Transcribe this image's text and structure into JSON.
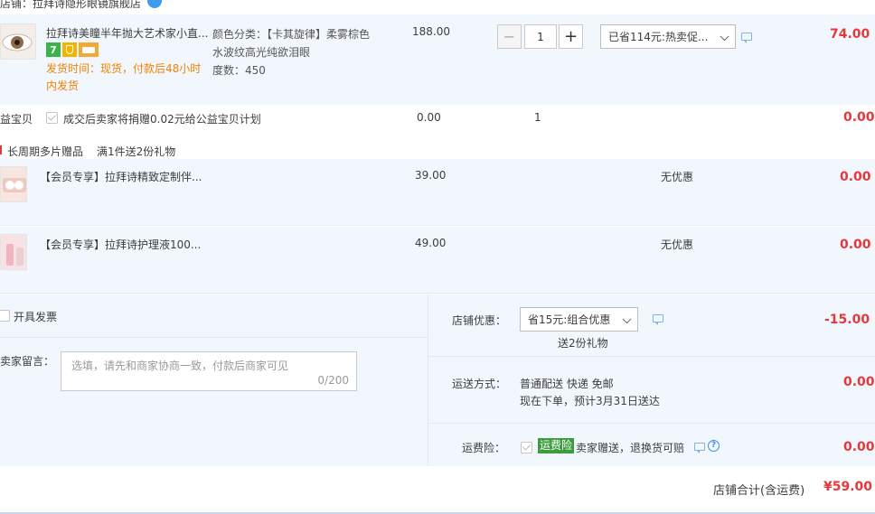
{
  "store": {
    "label": "店铺：拉拜诗隐形眼镜旗舰店"
  },
  "item": {
    "title": "拉拜诗美瞳半年抛大艺术家小直...",
    "ship_line1": "发货时间：现货，付款后48小时",
    "ship_line2": "内发货",
    "attr_line1": "颜色分类：【卡其旋律】柔雾棕色",
    "attr_line2": "水波纹高光纯欲泪眼",
    "attr_line3": "度数：450",
    "price": "188.00",
    "quantity": "1",
    "promo": "已省114元:热卖促...",
    "total": "74.00",
    "badge1": "7",
    "minus": "−",
    "plus": "+"
  },
  "charity": {
    "label": "公益宝贝",
    "text": "成交后卖家将捐赠0.02元给公益宝贝计划",
    "price": "0.00",
    "qty": "1",
    "total": "0.00"
  },
  "gifts": {
    "header_tag": "长周期多片赠品",
    "header_text": "满1件送2份礼物",
    "items": [
      {
        "title": "【会员专享】拉拜诗精致定制伴...",
        "price": "39.00",
        "promo": "无优惠",
        "total": "0.00"
      },
      {
        "title": "【会员专享】拉拜诗护理液100...",
        "price": "49.00",
        "promo": "无优惠",
        "total": "0.00"
      }
    ]
  },
  "invoice": {
    "label": "开具发票"
  },
  "message": {
    "label": "给卖家留言：",
    "placeholder": "选填，请先和商家协商一致，付款后商家可见",
    "counter": "0/200"
  },
  "shop_discount": {
    "label": "店铺优惠：",
    "select": "省15元:组合优惠",
    "sub": "送2份礼物",
    "amount": "-15.00"
  },
  "delivery": {
    "label": "运送方式：",
    "line1": "普通配送 快递 免邮",
    "line2": "现在下单，预计3月31日送达",
    "amount": "0.00"
  },
  "insurance": {
    "label": "运费险：",
    "tag": "运费险",
    "text": "卖家赠送，退换货可赔",
    "amount": "0.00"
  },
  "summary": {
    "label": "店铺合计(含运费)",
    "amount": "¥59.00"
  },
  "colors": {
    "accent_red": "#e4393c",
    "orange": "#f08200",
    "light_blue_bg": "#f2f7fd",
    "green_tag": "#3b9d3c"
  }
}
